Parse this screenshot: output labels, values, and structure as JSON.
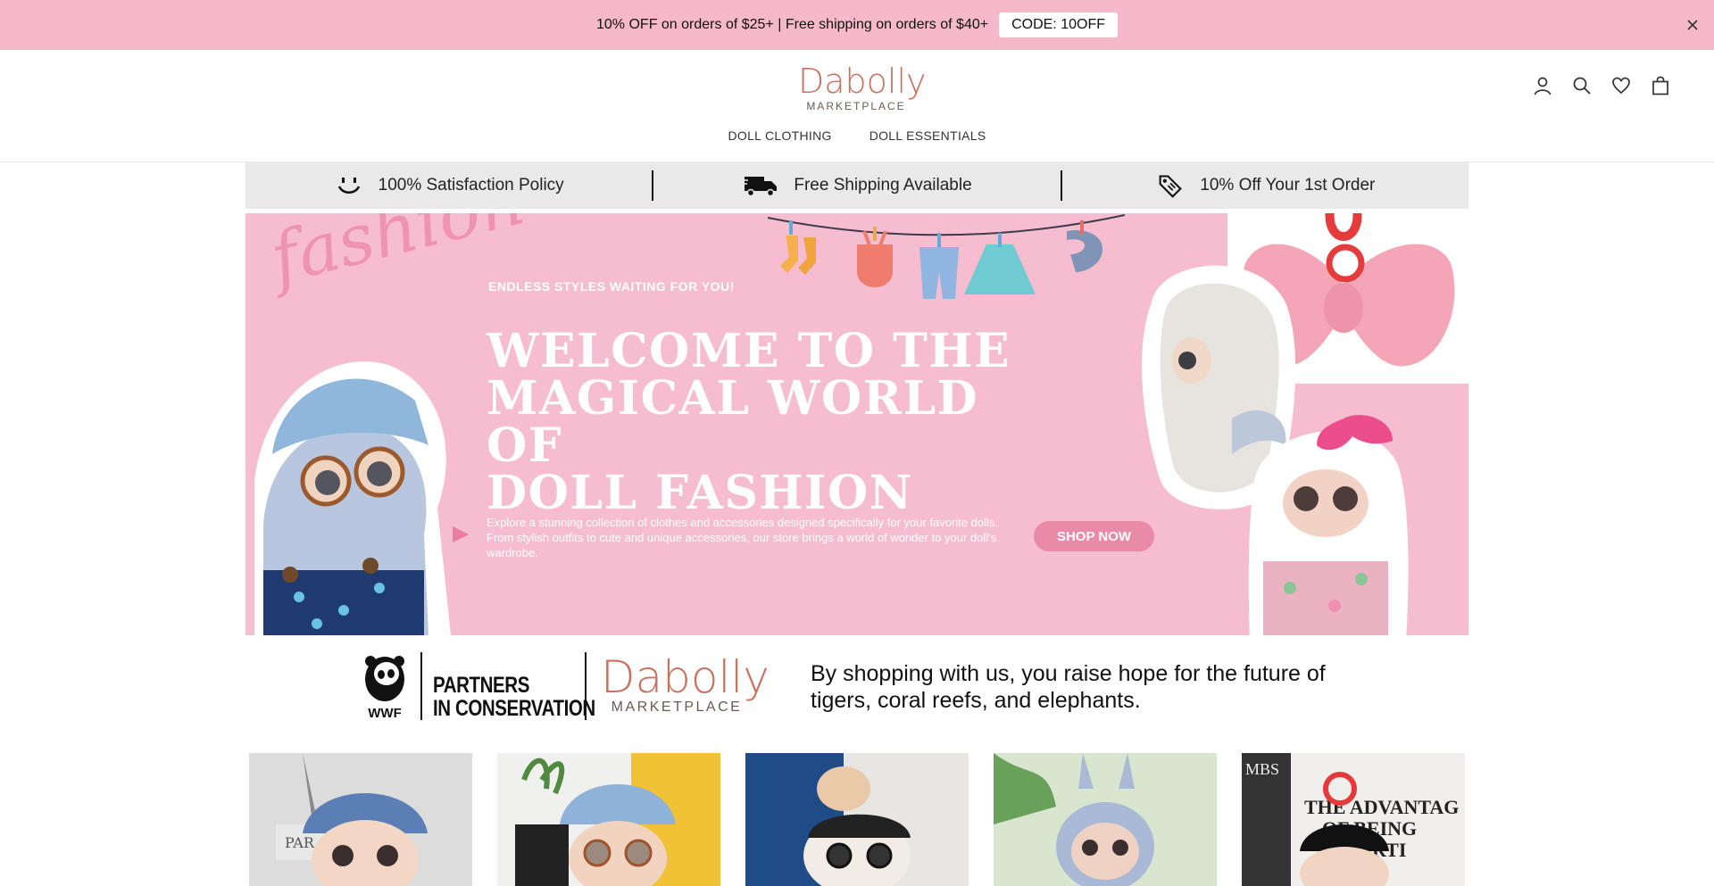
{
  "announcement": {
    "text": "10% OFF on orders of $25+ | Free shipping on orders of $40+",
    "code": "CODE: 10OFF"
  },
  "brand": {
    "name": "Dabolly",
    "sub": "MARKETPLACE",
    "color": "#c9705f"
  },
  "nav": {
    "items": [
      "DOLL CLOTHING",
      "DOLL ESSENTIALS"
    ]
  },
  "header_icons": [
    "account-icon",
    "search-icon",
    "wishlist-heart-icon",
    "cart-bag-icon"
  ],
  "features": [
    {
      "icon": "smile-icon",
      "label": "100% Satisfaction Policy"
    },
    {
      "icon": "truck-icon",
      "label": "Free Shipping Available"
    },
    {
      "icon": "price-tag-icon",
      "label": "10% Off Your 1st Order"
    }
  ],
  "hero": {
    "script_word": "fashion",
    "eyebrow": "ENDLESS STYLES WAITING FOR YOU!",
    "title_lines": [
      "WELCOME TO THE",
      "MAGICAL WORLD OF",
      "DOLL FASHION"
    ],
    "description": "Explore a stunning collection of clothes and accessories designed specifically for your favorite dolls. From stylish outfits to cute and unique accessories, our store brings a world of wonder to your doll's wardrobe.",
    "cta": "SHOP NOW",
    "bg_color": "#f6bccf"
  },
  "conservation": {
    "wwf_label": "WWF",
    "partners_line1": "PARTNERS",
    "partners_line2": "IN CONSERVATION",
    "text": "By shopping with us, you raise hope for the future of tigers, coral reefs, and elephants."
  },
  "products": [
    {
      "name": "product-1",
      "backdrop": "eiffel"
    },
    {
      "name": "product-2",
      "backdrop": "yellow"
    },
    {
      "name": "product-3",
      "backdrop": "blue-hand"
    },
    {
      "name": "product-4",
      "backdrop": "green"
    },
    {
      "name": "product-5",
      "backdrop": "newsprint"
    }
  ],
  "product_overlay_text": {
    "p1_sign": "PAR",
    "p5_text_lines": [
      "MBS",
      "THE ADVANTAG",
      "OF BEING",
      "N ARTI"
    ]
  }
}
